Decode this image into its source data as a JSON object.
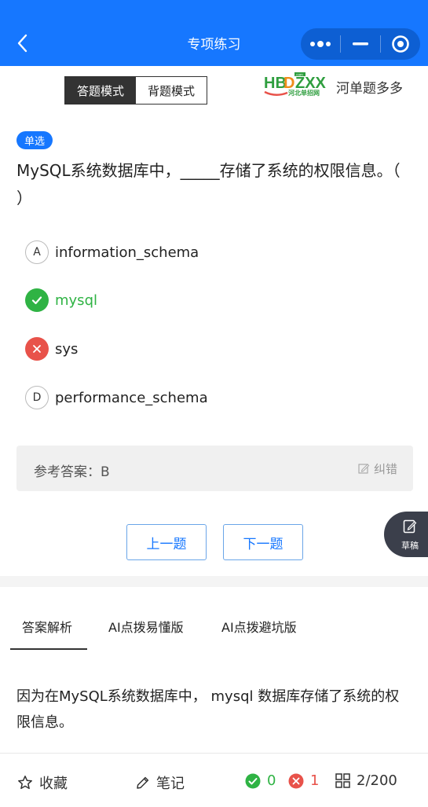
{
  "header": {
    "title": "专项练习",
    "bg_color": "#1677ff"
  },
  "mode_switch": {
    "active_label": "答题模式",
    "inactive_label": "背题模式"
  },
  "brand": {
    "logo_text": "HBDZXX",
    "logo_sub": "河北单招网",
    "logo_tag": ".com",
    "name": "河单题多多"
  },
  "question": {
    "type_badge": "单选",
    "text": "MySQL系统数据库中，_____存储了系统的权限信息。（   ）",
    "options": [
      {
        "letter": "A",
        "text": "information_schema",
        "state": "normal"
      },
      {
        "letter": "B",
        "text": "mysql",
        "state": "correct"
      },
      {
        "letter": "C",
        "text": "sys",
        "state": "wrong"
      },
      {
        "letter": "D",
        "text": "performance_schema",
        "state": "normal"
      }
    ]
  },
  "answer": {
    "label": "参考答案：B",
    "correction_label": "纠错"
  },
  "draft": {
    "label": "草稿"
  },
  "navigation": {
    "prev_label": "上一题",
    "next_label": "下一题"
  },
  "tabs": [
    {
      "label": "答案解析",
      "active": true
    },
    {
      "label": "AI点拨易懂版",
      "active": false
    },
    {
      "label": "AI点拨避坑版",
      "active": false
    }
  ],
  "explanation": "因为在MySQL系统数据库中， mysql 数据库存储了系统的权限信息。",
  "bottom_bar": {
    "favorite_label": "收藏",
    "note_label": "笔记",
    "correct_count": "0",
    "wrong_count": "1",
    "progress": "2/200"
  },
  "colors": {
    "accent": "#1677ff",
    "correct": "#2fb344",
    "wrong": "#e8524a"
  }
}
